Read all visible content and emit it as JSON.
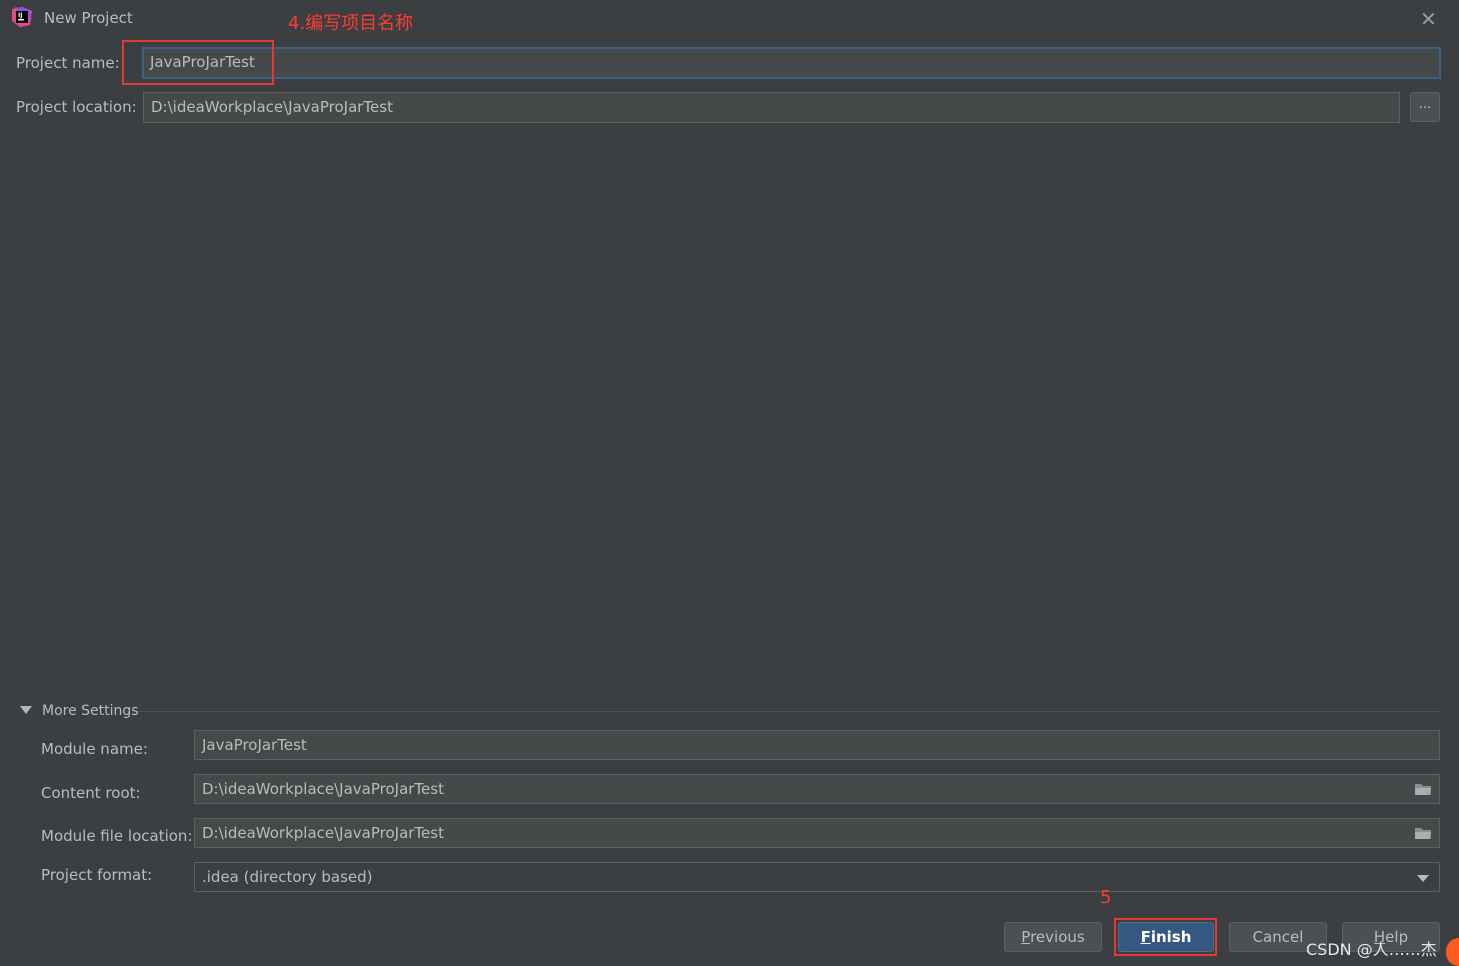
{
  "window": {
    "title": "New Project",
    "close_glyph": "✕"
  },
  "annotations": {
    "step4": "4.编写项目名称",
    "step5": "5"
  },
  "form": {
    "project_name_label": "Project name:",
    "project_name_value": "JavaProJarTest",
    "project_location_label": "Project location:",
    "project_location_value": "D:\\ideaWorkplace\\JavaProJarTest",
    "browse_label": "..."
  },
  "more_settings": {
    "title": "More Settings",
    "module_name_label": "Module name:",
    "module_name_value": "JavaProJarTest",
    "content_root_label": "Content root:",
    "content_root_value": "D:\\ideaWorkplace\\JavaProJarTest",
    "module_file_location_label": "Module file location:",
    "module_file_location_value": "D:\\ideaWorkplace\\JavaProJarTest",
    "project_format_label": "Project format:",
    "project_format_value": ".idea (directory based)"
  },
  "buttons": {
    "previous": "Previous",
    "finish": "Finish",
    "cancel": "Cancel",
    "help": "Help"
  },
  "watermark": "CSDN @人……杰",
  "colors": {
    "background": "#3c3f41",
    "field": "#45494a",
    "primary": "#365880",
    "annotation": "#e53935"
  },
  "icons": [
    "intellij-app-icon",
    "close-icon",
    "folder-icon",
    "triangle-down-icon",
    "chevron-down-icon"
  ]
}
